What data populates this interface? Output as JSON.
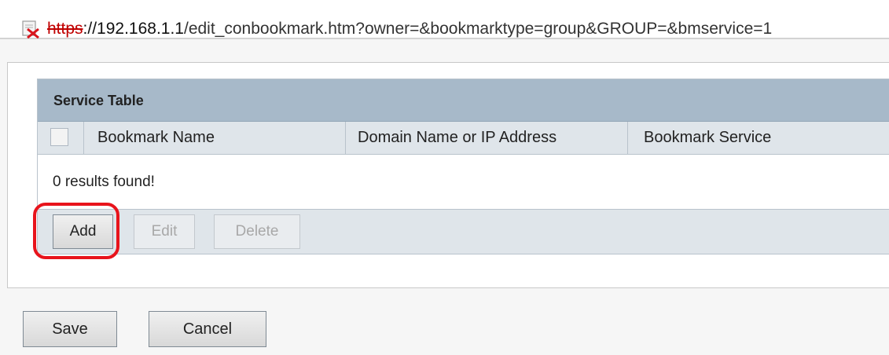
{
  "address_bar": {
    "icon": "certificate-error-icon",
    "url_protocol": "https",
    "url_host": "://192.168.1.1",
    "url_path": "/edit_conbookmark.htm?owner=&bookmarktype=group&GROUP=&bmservice=1"
  },
  "service_table": {
    "title": "Service Table",
    "columns": [
      "Bookmark Name",
      "Domain Name or IP Address",
      "Bookmark Service"
    ],
    "results_text": "0 results found!",
    "actions": {
      "add": "Add",
      "edit": "Edit",
      "delete": "Delete"
    }
  },
  "form_buttons": {
    "save": "Save",
    "cancel": "Cancel"
  },
  "colors": {
    "table_title_bg": "#a7b9c9",
    "table_header_bg": "#dfe5ea",
    "highlight": "#e8141c",
    "insecure_protocol": "#c00000"
  }
}
